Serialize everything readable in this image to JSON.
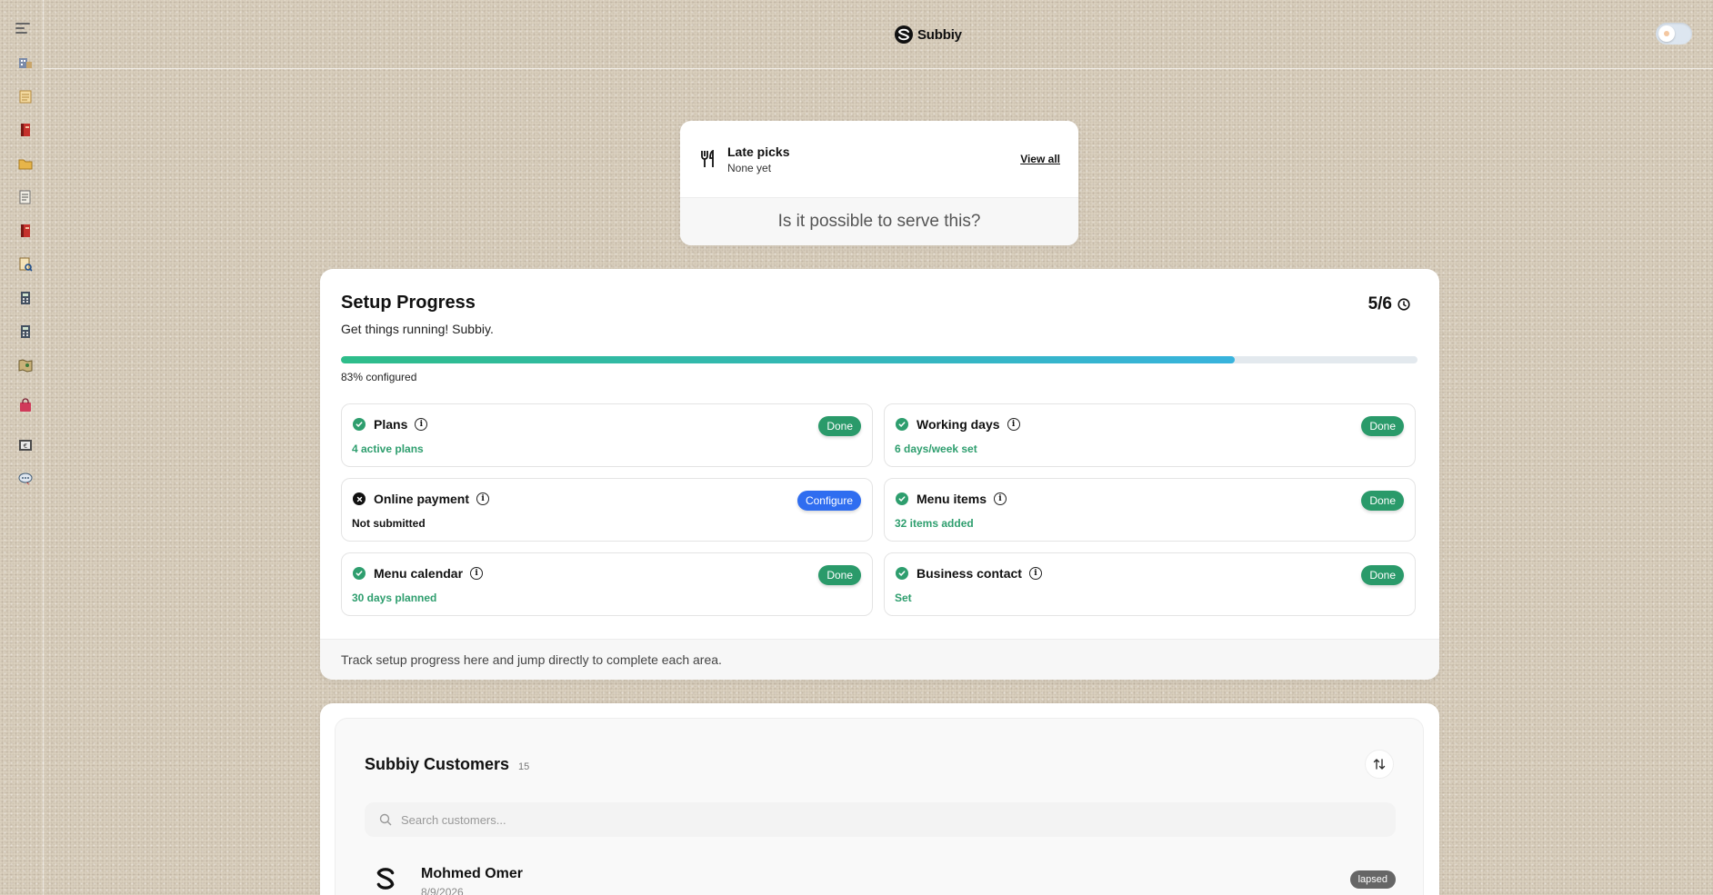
{
  "header": {
    "brand": "Subbiy"
  },
  "sidebar": {
    "items": [
      {
        "icon": "building-icon"
      },
      {
        "icon": "notepad-icon"
      },
      {
        "icon": "book-red-icon"
      },
      {
        "icon": "folder-icon"
      },
      {
        "icon": "document-icon"
      },
      {
        "icon": "book-red-icon"
      },
      {
        "icon": "search-document-icon"
      },
      {
        "icon": "calculator-icon"
      },
      {
        "icon": "calculator-icon"
      },
      {
        "icon": "map-icon"
      },
      {
        "icon": "shopping-bag-icon"
      },
      {
        "icon": "id-card-icon"
      },
      {
        "icon": "support-chat-icon"
      }
    ]
  },
  "late_picks": {
    "title": "Late picks",
    "subtitle": "None yet",
    "view_all": "View all",
    "question": "Is it possible to serve this?"
  },
  "setup": {
    "title": "Setup Progress",
    "subtitle": "Get things running! Subbiy.",
    "count": "5/6",
    "progress_fraction": 0.83,
    "progress_label": "83% configured",
    "tasks": [
      {
        "name": "Plans",
        "detail": "4 active plans",
        "status": "done",
        "button": "Done"
      },
      {
        "name": "Working days",
        "detail": "6 days/week set",
        "status": "done",
        "button": "Done"
      },
      {
        "name": "Online payment",
        "detail": "Not submitted",
        "status": "pending",
        "button": "Configure"
      },
      {
        "name": "Menu items",
        "detail": "32 items added",
        "status": "done",
        "button": "Done"
      },
      {
        "name": "Menu calendar",
        "detail": "30 days planned",
        "status": "done",
        "button": "Done"
      },
      {
        "name": "Business contact",
        "detail": "Set",
        "status": "done",
        "button": "Done"
      }
    ],
    "footer": "Track setup progress here and jump directly to complete each area."
  },
  "customers": {
    "title": "Subbiy Customers",
    "count": "15",
    "search_placeholder": "Search customers...",
    "rows": [
      {
        "name": "Mohmed Omer",
        "date": "8/9/2026",
        "status": "lapsed"
      }
    ]
  },
  "colors": {
    "done": "#2a9a6a",
    "configure": "#2f6df0",
    "progress_start": "#2ebd8a",
    "progress_end": "#38b3dd"
  }
}
